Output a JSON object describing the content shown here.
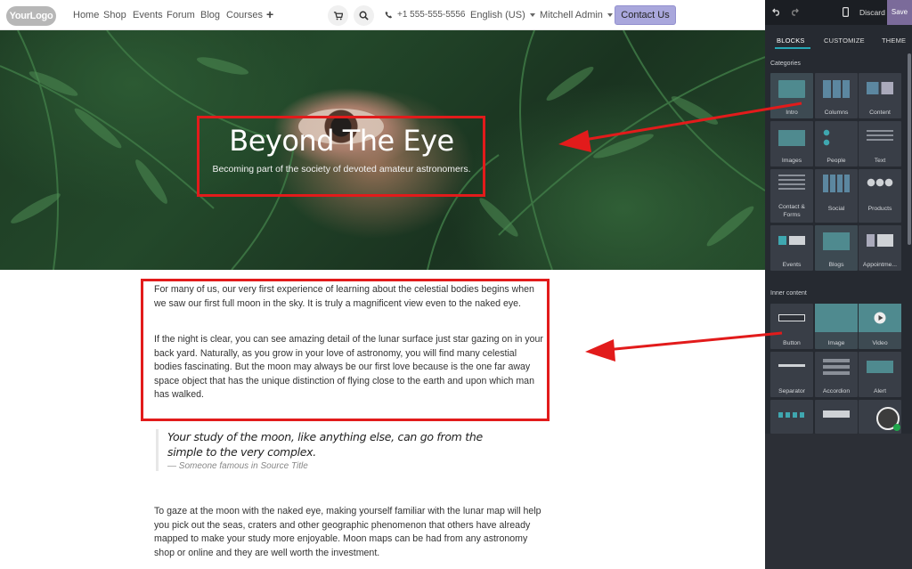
{
  "nav": {
    "logo": "YourLogo",
    "menu": [
      "Home",
      "Shop",
      "Events",
      "Forum",
      "Blog",
      "Courses"
    ],
    "plus": "+",
    "phone": "+1 555-555-5556",
    "language": "English (US)",
    "user": "Mitchell Admin",
    "contact_label": "Contact Us"
  },
  "hero": {
    "title": "Beyond The Eye",
    "subtitle": "Becoming part of the society of devoted amateur astronomers."
  },
  "content": {
    "p1": "For many of us, our very first experience of learning about the celestial bodies begins when we saw our first full moon in the sky. It is truly a magnificent view even to the naked eye.",
    "p2": "If the night is clear, you can see amazing detail of the lunar surface just star gazing on in your back yard. Naturally, as you grow in your love of astronomy, you will find many celestial bodies fascinating. But the moon may always be our first love because is the one far away space object that has the unique distinction of flying close to the earth and upon which man has walked.",
    "quote": "Your study of the moon, like anything else, can go from the simple to the very complex.",
    "cite": "— Someone famous in Source Title",
    "p3": "To gaze at the moon with the naked eye, making yourself familiar with the lunar map will help you pick out the seas, craters and other geographic phenomenon that others have already mapped to make your study more enjoyable. Moon maps can be had from any astronomy shop or online and they are well worth the investment."
  },
  "editor": {
    "discard_label": "Discard",
    "save_label": "Save",
    "tabs": [
      "BLOCKS",
      "CUSTOMIZE",
      "THEME"
    ],
    "active_tab": "BLOCKS",
    "categories_label": "Categories",
    "categories": [
      "Intro",
      "Columns",
      "Content",
      "Images",
      "People",
      "Text",
      "Contact & Forms",
      "Social",
      "Products",
      "Events",
      "Blogs",
      "Appointme..."
    ],
    "inner_label": "Inner content",
    "inner": [
      "Button",
      "Image",
      "Video",
      "Separator",
      "Accordion",
      "Alert",
      "",
      "",
      ""
    ]
  },
  "colors": {
    "contact_button": "#a9a7dc",
    "annotation": "#e21b1b",
    "panel_bg": "#262a31",
    "active_tab_underline": "#27a7b5",
    "save_button": "#7b6b9a"
  }
}
